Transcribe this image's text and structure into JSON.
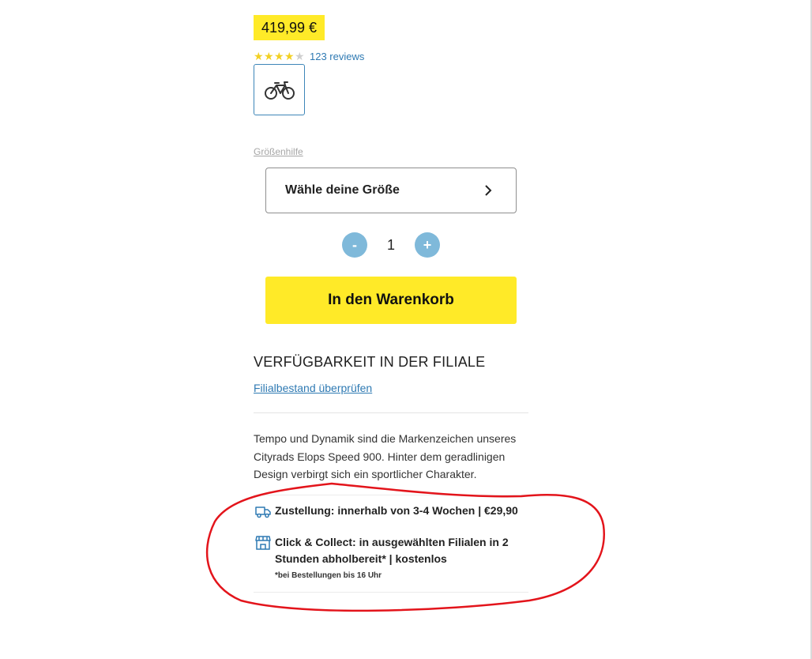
{
  "product": {
    "price": "419,99 €",
    "rating": 4.5,
    "reviews_label": "123 reviews",
    "thumbnail_icon": "bicycle-icon"
  },
  "size": {
    "help_link": "Größenhilfe",
    "select_label": "Wähle deine Größe"
  },
  "quantity": {
    "minus_label": "-",
    "value": "1",
    "plus_label": "+"
  },
  "cart_button_label": "In den Warenkorb",
  "availability": {
    "title": "VERFÜGBARKEIT IN DER FILIALE",
    "link": "Filialbestand überprüfen"
  },
  "description": "Tempo und Dynamik sind die Markenzeichen unseres Cityrads Elops Speed 900. Hinter dem geradlinigen Design verbirgt sich ein sportlicher Charakter.",
  "shipping": {
    "delivery": "Zustellung: innerhalb von 3-4 Wochen | €29,90",
    "delivery_icon": "delivery-truck-icon",
    "collect": "Click & Collect: in ausgewählten Filialen in 2 Stunden abholbereit* | kostenlos",
    "collect_icon": "store-icon",
    "note": "*bei Bestellungen bis 16 Uhr"
  },
  "colors": {
    "accent_yellow": "#ffea28",
    "link_blue": "#2f7ab3",
    "qty_button": "#7fb9da",
    "annotation_red": "#e3141b"
  }
}
